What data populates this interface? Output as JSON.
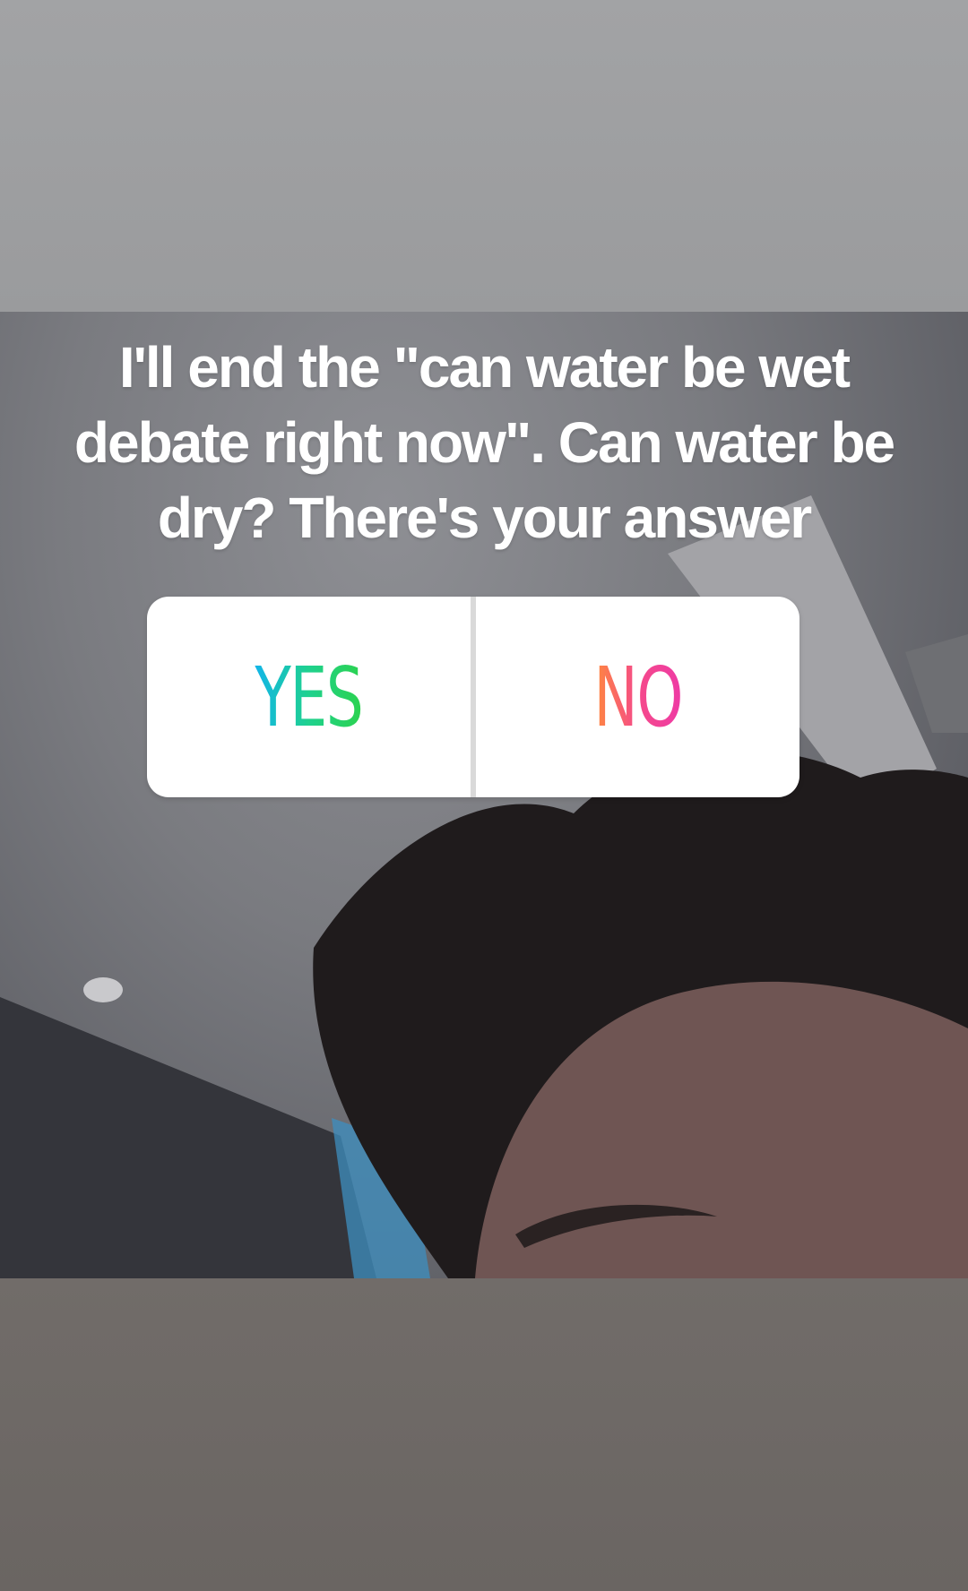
{
  "story": {
    "caption_lines": [
      "I'll end the \"can water be wet",
      "debate right now\". Can water be",
      "dry? There's your answer"
    ]
  },
  "poll": {
    "option_yes": "YES",
    "option_no": "NO",
    "yes_gradient": [
      "#12b5e8",
      "#2bd24e"
    ],
    "no_gradient": [
      "#ff8a3c",
      "#ee3aa5"
    ]
  }
}
